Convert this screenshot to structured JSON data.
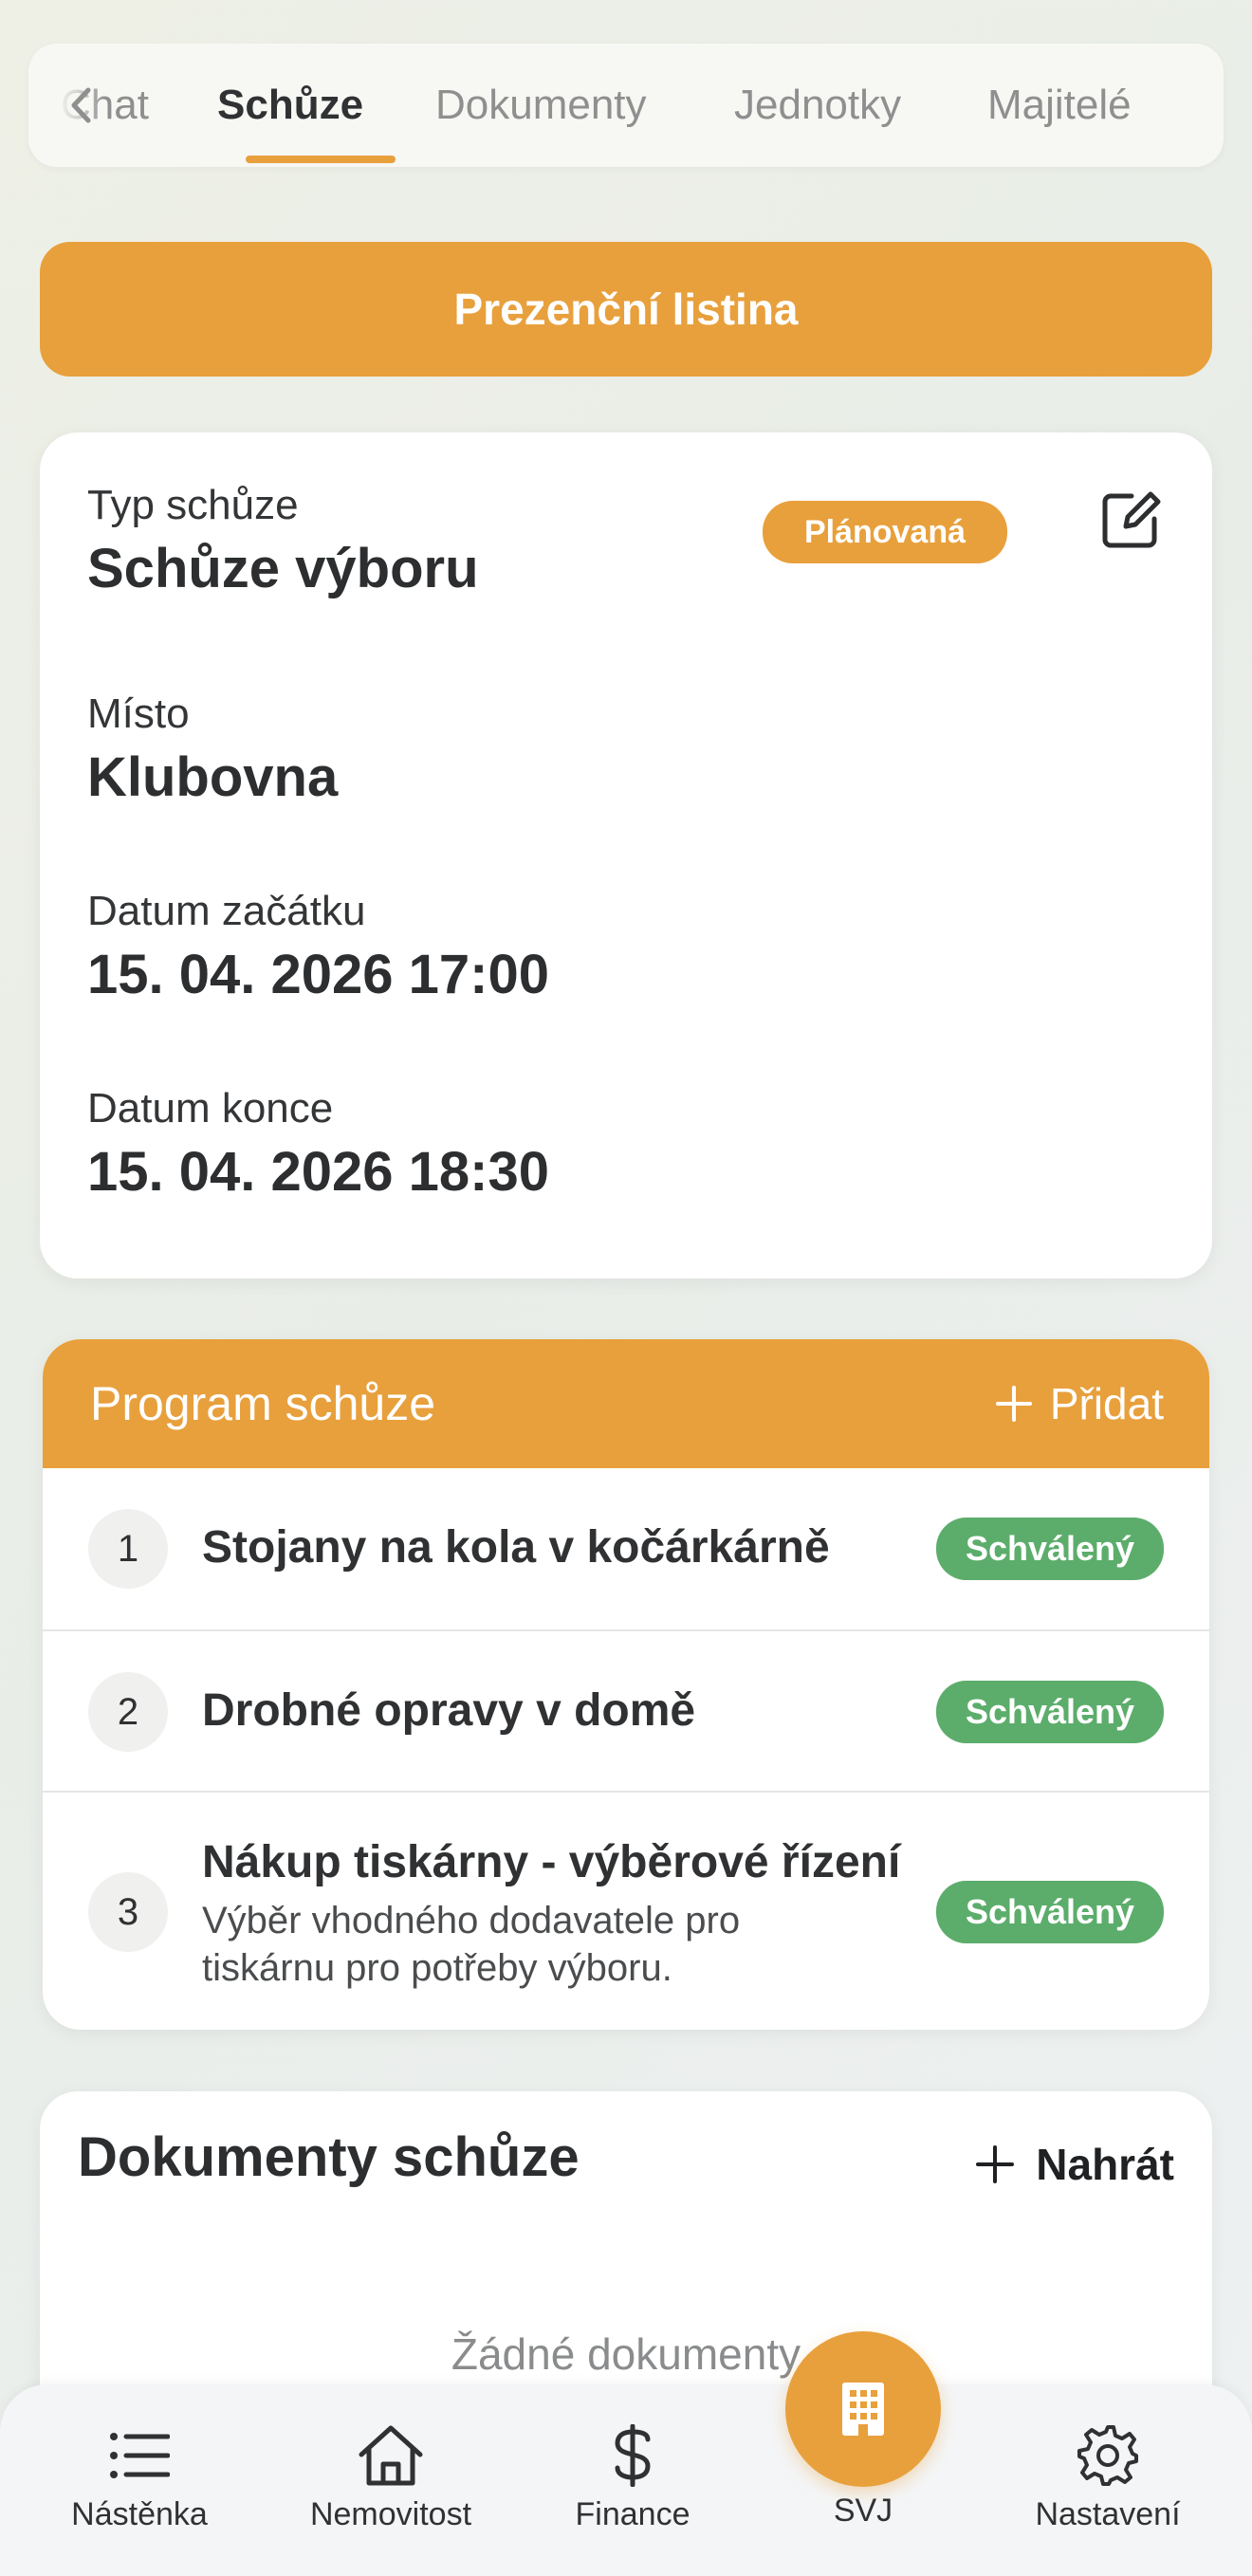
{
  "tabs": [
    {
      "label": "Chat",
      "active": false
    },
    {
      "label": "Schůze",
      "active": true
    },
    {
      "label": "Dokumenty",
      "active": false
    },
    {
      "label": "Jednotky",
      "active": false
    },
    {
      "label": "Majitelé",
      "active": false
    }
  ],
  "attendance_button": "Prezenční listina",
  "details": {
    "status_badge": "Plánovaná",
    "type_label": "Typ schůze",
    "type_value": "Schůze výboru",
    "place_label": "Místo",
    "place_value": "Klubovna",
    "start_label": "Datum začátku",
    "start_value": "15. 04. 2026 17:00",
    "end_label": "Datum konce",
    "end_value": "15. 04. 2026 18:30",
    "edit_icon": "edit-icon"
  },
  "program": {
    "title": "Program schůze",
    "add_label": "Přidat",
    "items": [
      {
        "number": "1",
        "title": "Stojany na kola v kočárkárně",
        "description": "",
        "status": "Schválený"
      },
      {
        "number": "2",
        "title": "Drobné opravy v domě",
        "description": "",
        "status": "Schválený"
      },
      {
        "number": "3",
        "title": "Nákup tiskárny - výběrové řízení",
        "description": "Výběr vhodného dodavatele pro tiskárnu pro potřeby výboru.",
        "status": "Schválený"
      }
    ]
  },
  "documents": {
    "title": "Dokumenty schůze",
    "upload_label": "Nahrát",
    "empty_text": "Žádné dokumenty"
  },
  "bottom_nav": [
    {
      "label": "Nástěnka",
      "icon": "list-icon"
    },
    {
      "label": "Nemovitost",
      "icon": "house-icon"
    },
    {
      "label": "Finance",
      "icon": "dollar-icon"
    },
    {
      "label": "SVJ",
      "icon": "building-icon"
    },
    {
      "label": "Nastavení",
      "icon": "gear-icon"
    }
  ],
  "colors": {
    "accent": "#e8a03c",
    "approved": "#5cad6b",
    "text": "#2f3133",
    "muted": "#8e8f8f"
  }
}
